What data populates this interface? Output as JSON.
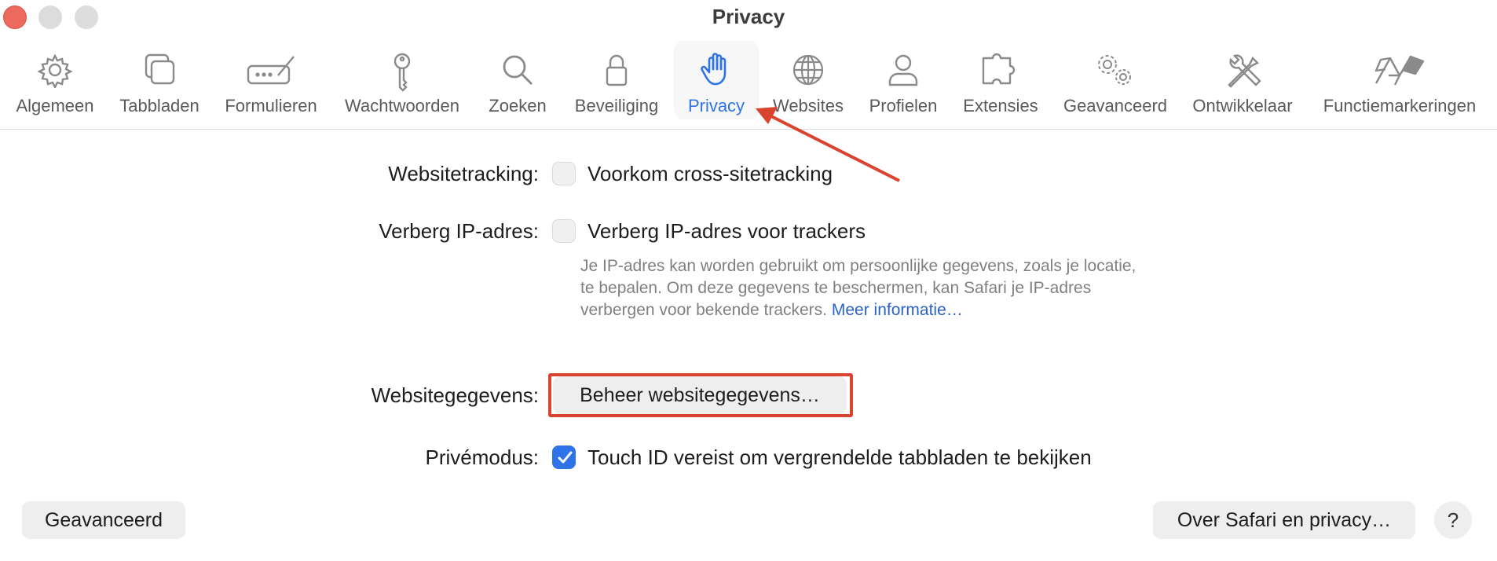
{
  "window": {
    "title": "Privacy"
  },
  "toolbar": {
    "tabs": [
      {
        "label": "Algemeen",
        "icon": "gear-icon"
      },
      {
        "label": "Tabbladen",
        "icon": "tabs-icon"
      },
      {
        "label": "Formulieren",
        "icon": "autofill-form-icon"
      },
      {
        "label": "Wachtwoorden",
        "icon": "key-icon"
      },
      {
        "label": "Zoeken",
        "icon": "magnifier-icon"
      },
      {
        "label": "Beveiliging",
        "icon": "lock-icon"
      },
      {
        "label": "Privacy",
        "icon": "hand-icon",
        "active": true
      },
      {
        "label": "Websites",
        "icon": "globe-icon"
      },
      {
        "label": "Profielen",
        "icon": "person-icon"
      },
      {
        "label": "Extensies",
        "icon": "puzzle-icon"
      },
      {
        "label": "Geavanceerd",
        "icon": "gears-icon"
      },
      {
        "label": "Ontwikkelaar",
        "icon": "tools-icon"
      },
      {
        "label": "Functiemarkeringen",
        "icon": "flags-icon"
      }
    ]
  },
  "privacy": {
    "tracking": {
      "label": "Websitetracking:",
      "option": "Voorkom cross-sitetracking",
      "checked": false
    },
    "hide_ip": {
      "label": "Verberg IP-adres:",
      "option": "Verberg IP-adres voor trackers",
      "checked": false,
      "description": "Je IP-adres kan worden gebruikt om persoonlijke gegevens, zoals je locatie, te bepalen. Om deze gegevens te beschermen, kan Safari je IP-adres verbergen voor bekende trackers.",
      "link": "Meer informatie…"
    },
    "website_data": {
      "label": "Websitegegevens:",
      "button": "Beheer websitegegevens…"
    },
    "private_mode": {
      "label": "Privémodus:",
      "option": "Touch ID vereist om vergrendelde tabbladen te bekijken",
      "checked": true
    }
  },
  "footer": {
    "advanced_button": "Geavanceerd",
    "about_button": "Over Safari en privacy…",
    "help_button": "?"
  },
  "colors": {
    "accent": "#2f73e8",
    "annotation_red": "#d9442e",
    "close_red": "#ed6a5e"
  }
}
